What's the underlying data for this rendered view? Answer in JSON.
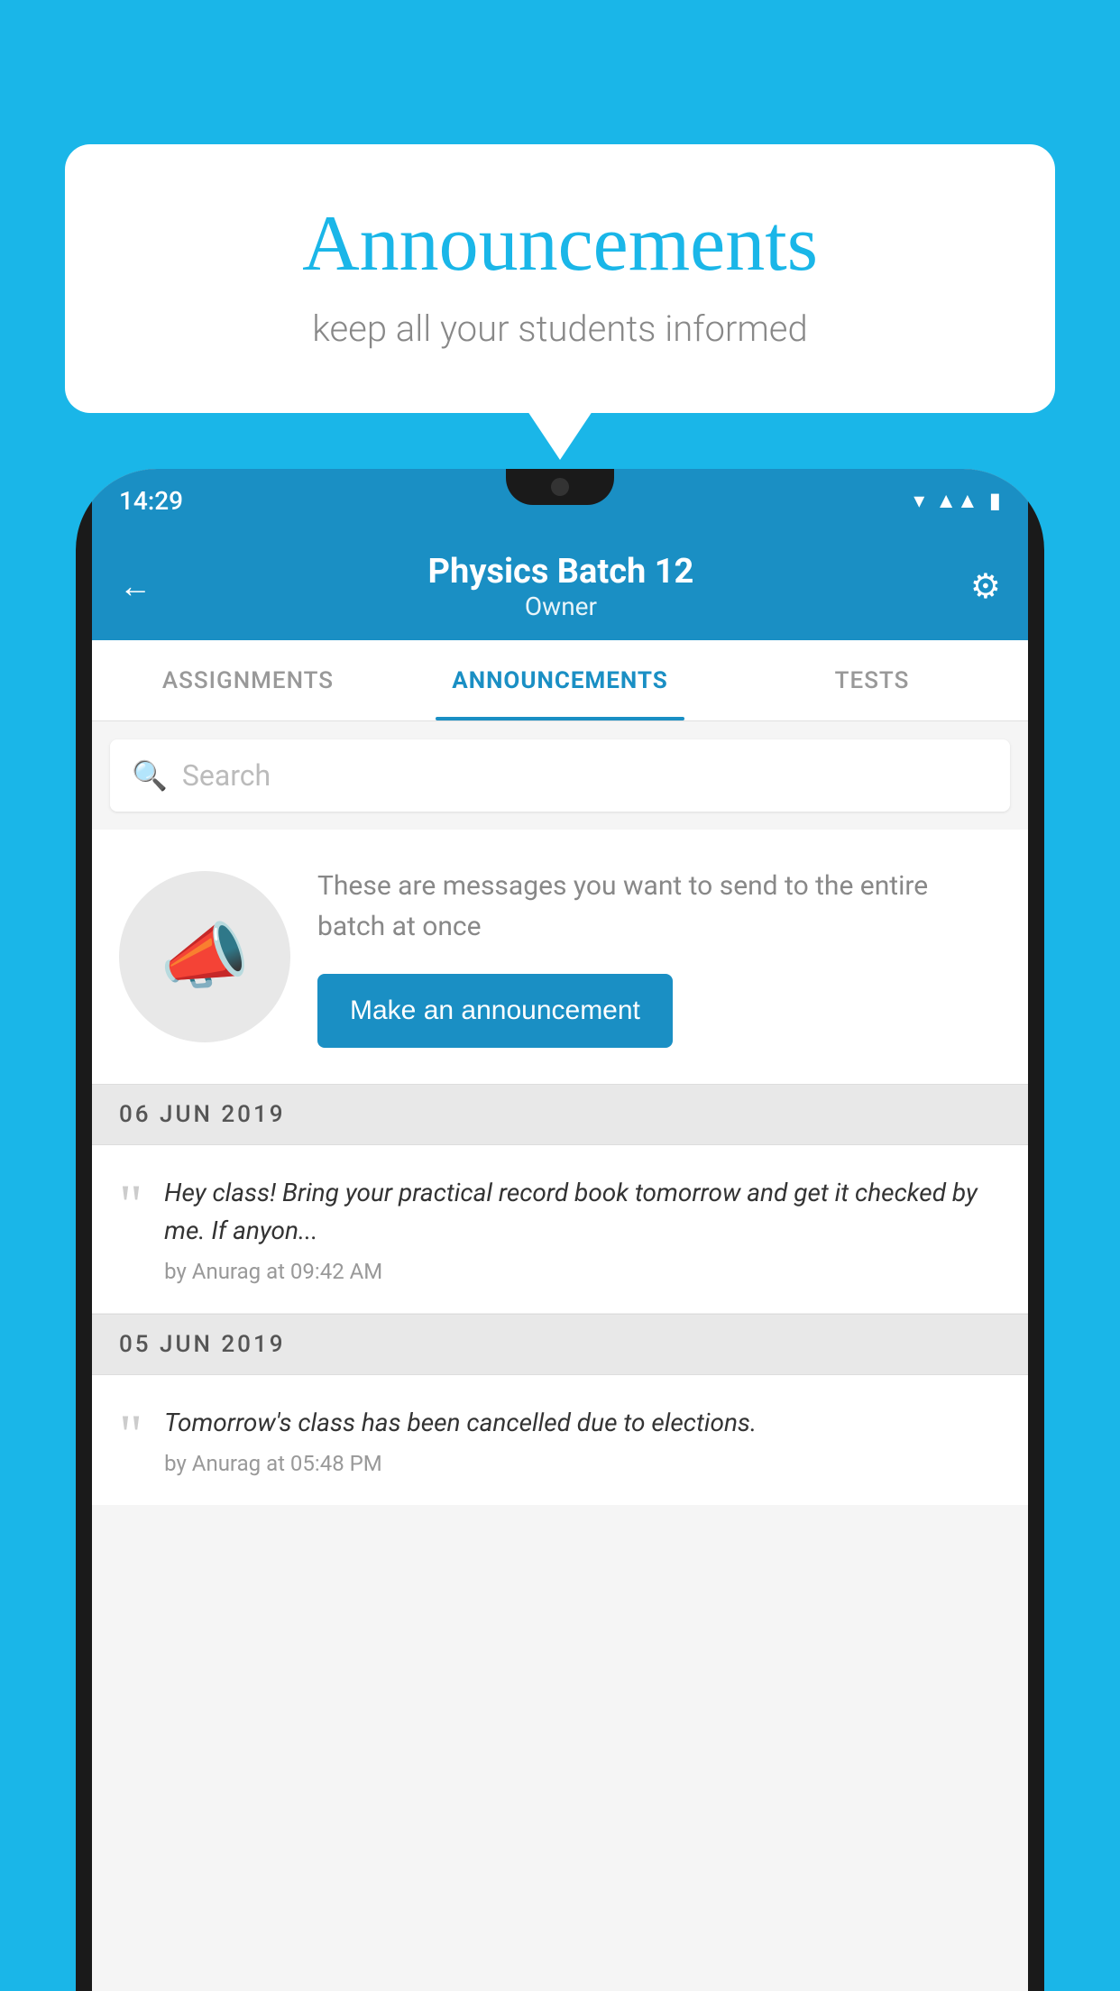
{
  "page": {
    "background_color": "#1ab6e8"
  },
  "speech_bubble": {
    "title": "Announcements",
    "subtitle": "keep all your students informed"
  },
  "phone": {
    "status_bar": {
      "time": "14:29",
      "signal_icon": "▼▲",
      "battery_icon": "▮"
    },
    "header": {
      "back_icon": "←",
      "title": "Physics Batch 12",
      "subtitle": "Owner",
      "settings_icon": "⚙"
    },
    "tabs": [
      {
        "label": "ASSIGNMENTS",
        "active": false
      },
      {
        "label": "ANNOUNCEMENTS",
        "active": true
      },
      {
        "label": "TESTS",
        "active": false
      },
      {
        "label": "...",
        "active": false
      }
    ],
    "search": {
      "placeholder": "Search"
    },
    "empty_state": {
      "description": "These are messages you want to send to the entire batch at once",
      "button_label": "Make an announcement"
    },
    "announcements": [
      {
        "date": "06  JUN  2019",
        "text": "Hey class! Bring your practical record book tomorrow and get it checked by me. If anyon...",
        "meta": "by Anurag at 09:42 AM"
      },
      {
        "date": "05  JUN  2019",
        "text": "Tomorrow's class has been cancelled due to elections.",
        "meta": "by Anurag at 05:48 PM"
      }
    ]
  }
}
